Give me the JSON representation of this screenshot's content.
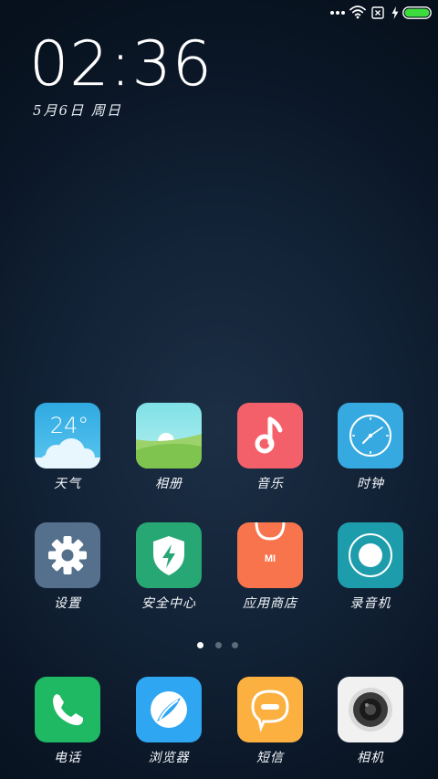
{
  "clock": {
    "time": "02:36",
    "date": "5月6日 周日"
  },
  "status_bar": {
    "icons": [
      "more-dots-icon",
      "wifi-icon",
      "no-sim-icon",
      "charging-bolt-icon",
      "battery-icon"
    ],
    "battery_color": "#3ddc3d",
    "battery_level": 1.0
  },
  "pages": {
    "count": 3,
    "active_index": 0
  },
  "apps": [
    {
      "label": "天气",
      "icon": "weather-icon",
      "temperature": "24°",
      "color": "#39b6e3"
    },
    {
      "label": "相册",
      "icon": "gallery-icon",
      "color": "#8edf9a"
    },
    {
      "label": "音乐",
      "icon": "music-note-icon",
      "color": "#f4606a"
    },
    {
      "label": "时钟",
      "icon": "clock-icon",
      "color": "#36a9e0"
    },
    {
      "label": "设置",
      "icon": "gear-icon",
      "color": "#55708c"
    },
    {
      "label": "安全中心",
      "icon": "shield-bolt-icon",
      "color": "#26a774"
    },
    {
      "label": "应用商店",
      "icon": "store-bag-icon",
      "badge": "MI",
      "color": "#f7744c"
    },
    {
      "label": "录音机",
      "icon": "record-icon",
      "color": "#1d9cac"
    }
  ],
  "dock": [
    {
      "label": "电话",
      "icon": "phone-icon",
      "color": "#1fb863"
    },
    {
      "label": "浏览器",
      "icon": "browser-icon",
      "color": "#2fa6f1"
    },
    {
      "label": "短信",
      "icon": "message-bubble-icon",
      "color": "#fbb040"
    },
    {
      "label": "相机",
      "icon": "camera-icon",
      "color": "#f1f1f1"
    }
  ]
}
